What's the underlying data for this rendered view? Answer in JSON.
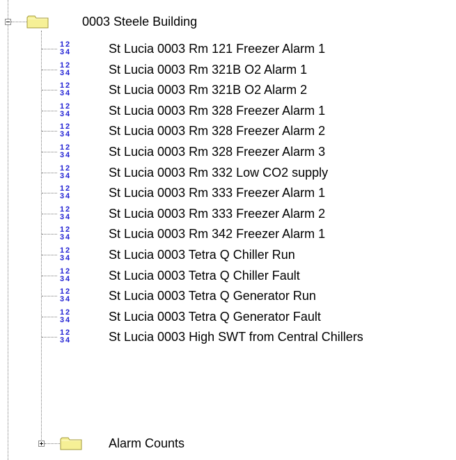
{
  "tree": {
    "root": {
      "label": "0003 Steele Building",
      "icon": "folder-icon",
      "expanded": true
    },
    "items": [
      {
        "label": "St Lucia 0003 Rm 121 Freezer Alarm 1",
        "icon": "numeric-point-icon"
      },
      {
        "label": "St Lucia 0003 Rm 321B O2 Alarm 1",
        "icon": "numeric-point-icon"
      },
      {
        "label": "St Lucia 0003 Rm 321B O2 Alarm 2",
        "icon": "numeric-point-icon"
      },
      {
        "label": "St Lucia 0003 Rm 328 Freezer Alarm 1",
        "icon": "numeric-point-icon"
      },
      {
        "label": "St Lucia 0003 Rm 328 Freezer Alarm 2",
        "icon": "numeric-point-icon"
      },
      {
        "label": "St Lucia 0003 Rm 328 Freezer Alarm 3",
        "icon": "numeric-point-icon"
      },
      {
        "label": "St Lucia 0003 Rm 332 Low CO2 supply",
        "icon": "numeric-point-icon"
      },
      {
        "label": "St Lucia 0003 Rm 333 Freezer Alarm 1",
        "icon": "numeric-point-icon"
      },
      {
        "label": "St Lucia 0003 Rm 333 Freezer Alarm 2",
        "icon": "numeric-point-icon"
      },
      {
        "label": "St Lucia 0003 Rm 342 Freezer Alarm 1",
        "icon": "numeric-point-icon"
      },
      {
        "label": "St Lucia 0003 Tetra Q Chiller Run",
        "icon": "numeric-point-icon"
      },
      {
        "label": "St Lucia 0003 Tetra Q Chiller Fault",
        "icon": "numeric-point-icon"
      },
      {
        "label": "St Lucia 0003 Tetra Q Generator Run",
        "icon": "numeric-point-icon"
      },
      {
        "label": "St Lucia 0003 Tetra Q Generator Fault",
        "icon": "numeric-point-icon"
      },
      {
        "label": "St Lucia 0003 High SWT from Central Chillers",
        "icon": "numeric-point-icon"
      }
    ],
    "subfolder": {
      "label": "Alarm Counts",
      "icon": "folder-icon",
      "expanded": false
    },
    "colors": {
      "folder_fill": "#f6f096",
      "folder_edge": "#a39a3a",
      "numeric_icon": "#2222d4",
      "tree_lines": "#7a7a7a"
    }
  }
}
